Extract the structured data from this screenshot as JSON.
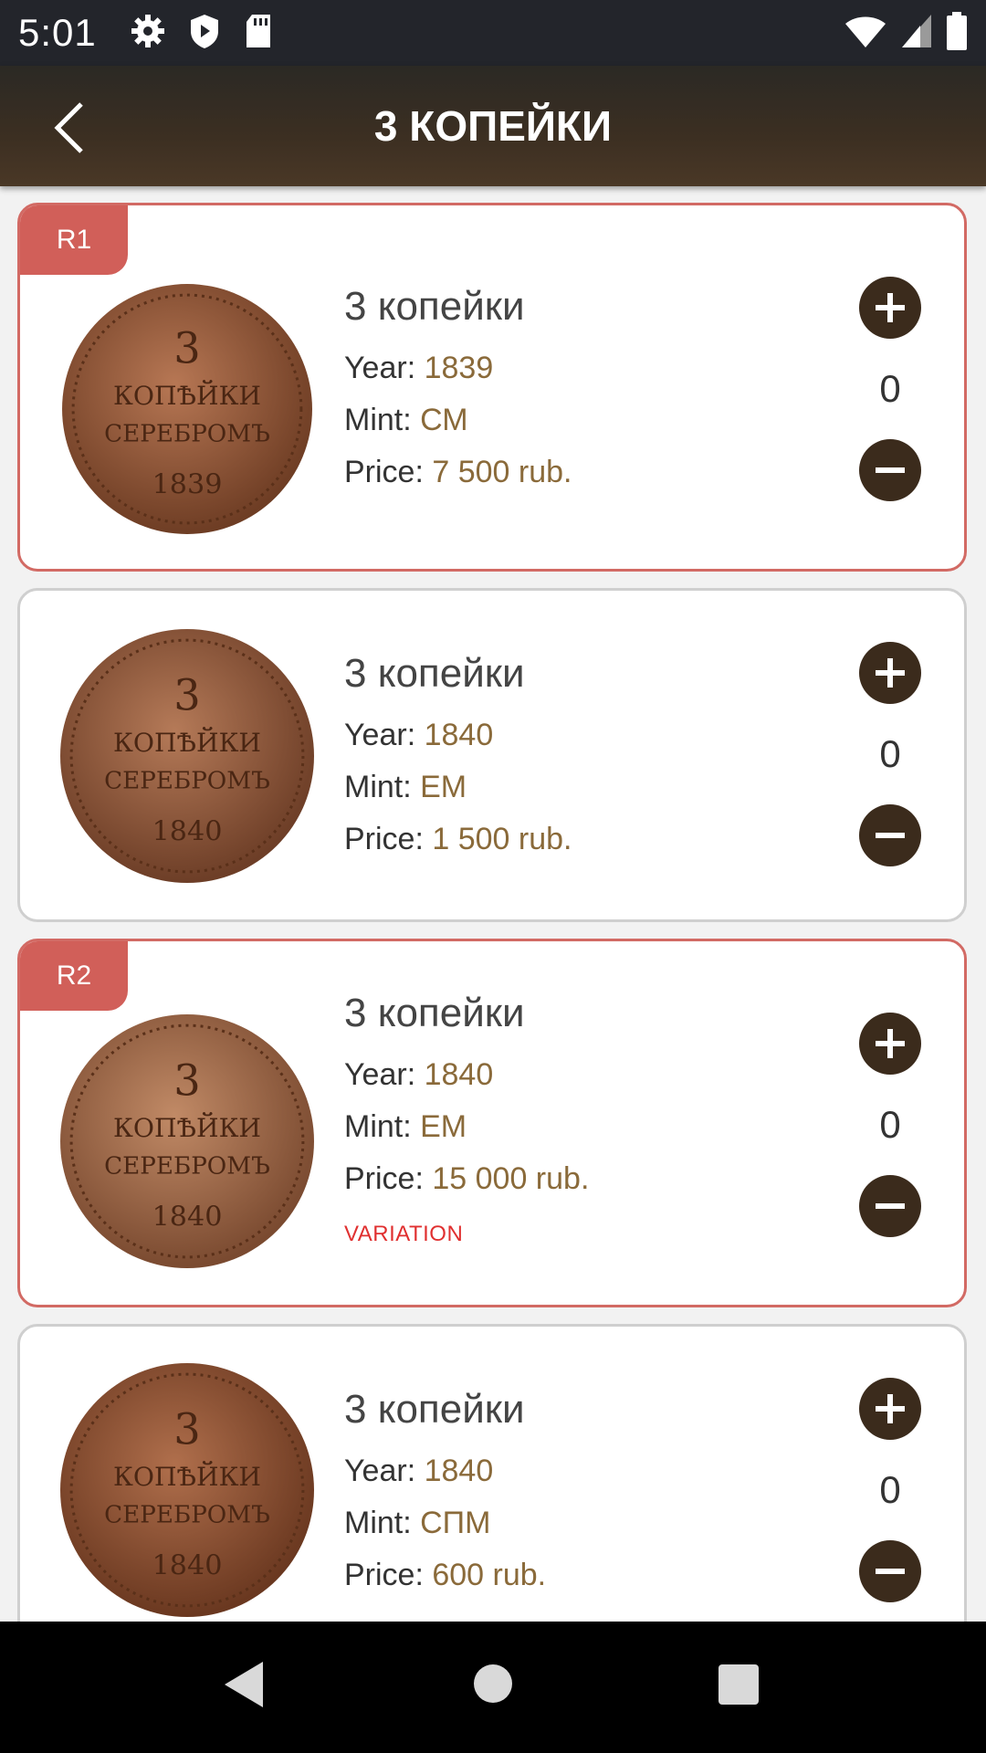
{
  "status": {
    "time": "5:01"
  },
  "appbar": {
    "title": "3 КОПЕЙКИ"
  },
  "labels": {
    "year": "Year: ",
    "mint": "Mint: ",
    "price": "Price: "
  },
  "coins": [
    {
      "badge": "R1",
      "name": "3 копейки",
      "year": "1839",
      "mint": "СМ",
      "price": "7 500 rub.",
      "count": "0",
      "note": ""
    },
    {
      "badge": "",
      "name": "3 копейки",
      "year": "1840",
      "mint": "ЕМ",
      "price": "1 500 rub.",
      "count": "0",
      "note": ""
    },
    {
      "badge": "R2",
      "name": "3 копейки",
      "year": "1840",
      "mint": "ЕМ",
      "price": "15 000 rub.",
      "count": "0",
      "note": "VARIATION"
    },
    {
      "badge": "",
      "name": "3 копейки",
      "year": "1840",
      "mint": "СПМ",
      "price": "600 rub.",
      "count": "0",
      "note": ""
    }
  ],
  "coin_face": {
    "denomination": "3",
    "word1": "КОПѢЙКИ",
    "word2": "СЕРЕБРОМЪ"
  },
  "colors": {
    "accent": "#3b2b1c",
    "rare_border": "#d26a64",
    "value_text": "#8a6a3a",
    "variation": "#e03030"
  }
}
